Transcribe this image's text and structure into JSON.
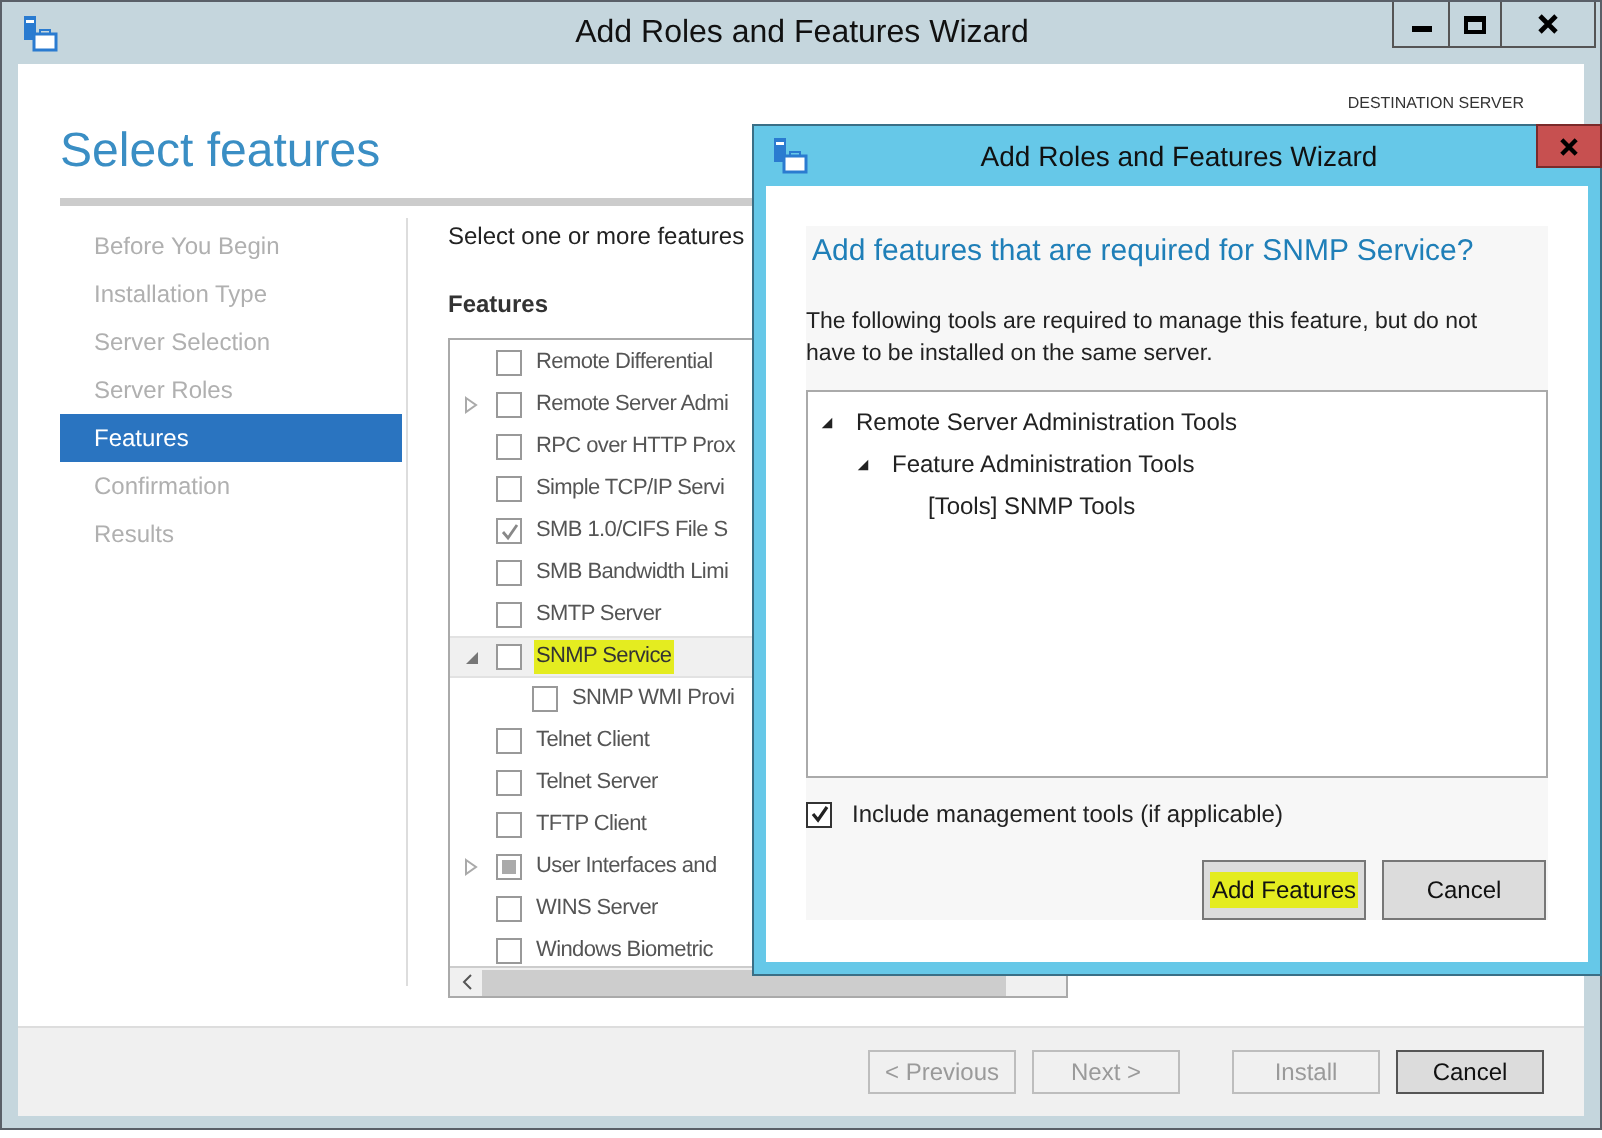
{
  "window": {
    "title": "Add Roles and Features Wizard"
  },
  "page_title": "Select features",
  "destination_label": "DESTINATION SERVER",
  "steps": [
    {
      "label": "Before You Begin",
      "selected": false
    },
    {
      "label": "Installation Type",
      "selected": false
    },
    {
      "label": "Server Selection",
      "selected": false
    },
    {
      "label": "Server Roles",
      "selected": false
    },
    {
      "label": "Features",
      "selected": true
    },
    {
      "label": "Confirmation",
      "selected": false
    },
    {
      "label": "Results",
      "selected": false
    }
  ],
  "instruction": "Select one or more features",
  "features_heading": "Features",
  "features": [
    {
      "label": "Remote Differential",
      "checked": false,
      "selected": false,
      "highlighted": false
    },
    {
      "label": "Remote Server Admi",
      "expanded": false,
      "checked": false,
      "selected": false,
      "highlighted": false
    },
    {
      "label": "RPC over HTTP Prox",
      "checked": false,
      "selected": false,
      "highlighted": false
    },
    {
      "label": "Simple TCP/IP Servi",
      "checked": false,
      "selected": false,
      "highlighted": false
    },
    {
      "label": "SMB 1.0/CIFS File S",
      "checked": true,
      "selected": false,
      "highlighted": false
    },
    {
      "label": "SMB Bandwidth Limi",
      "checked": false,
      "selected": false,
      "highlighted": false
    },
    {
      "label": "SMTP Server",
      "checked": false,
      "selected": false,
      "highlighted": false
    },
    {
      "label": "SNMP Service",
      "expanded": true,
      "checked": false,
      "selected": true,
      "highlighted": true,
      "children": [
        {
          "label": "SNMP WMI Provi",
          "checked": false,
          "selected": false,
          "highlighted": false
        }
      ]
    },
    {
      "label": "Telnet Client",
      "checked": false,
      "selected": false,
      "highlighted": false
    },
    {
      "label": "Telnet Server",
      "checked": false,
      "selected": false,
      "highlighted": false
    },
    {
      "label": "TFTP Client",
      "checked": false,
      "selected": false,
      "highlighted": false
    },
    {
      "label": "User Interfaces and",
      "expanded": false,
      "indeterminate": true,
      "selected": false,
      "highlighted": false
    },
    {
      "label": "WINS Server",
      "checked": false,
      "selected": false,
      "highlighted": false
    },
    {
      "label": "Windows Biometric",
      "checked": false,
      "selected": false,
      "highlighted": false
    }
  ],
  "buttons": [
    {
      "label": "< Previous",
      "disabled": true
    },
    {
      "label": "Next >",
      "disabled": true
    },
    {
      "label": "Install",
      "disabled": true
    },
    {
      "label": "Cancel",
      "disabled": false
    }
  ],
  "dialog": {
    "title": "Add Roles and Features Wizard",
    "heading": "Add features that are required for SNMP Service?",
    "description": "The following tools are required to manage this feature, but do not have to be installed on the same server.",
    "tree": [
      {
        "label": "Remote Server Administration Tools",
        "expanded": true,
        "children": [
          {
            "label": "Feature Administration Tools",
            "expanded": true,
            "children": [
              {
                "label": "[Tools] SNMP Tools"
              }
            ]
          }
        ]
      }
    ],
    "include_tools": {
      "label": "Include management tools (if applicable)",
      "checked": true
    },
    "buttons": [
      {
        "label": "Add Features",
        "highlighted": true
      },
      {
        "label": "Cancel",
        "highlighted": false
      }
    ]
  }
}
